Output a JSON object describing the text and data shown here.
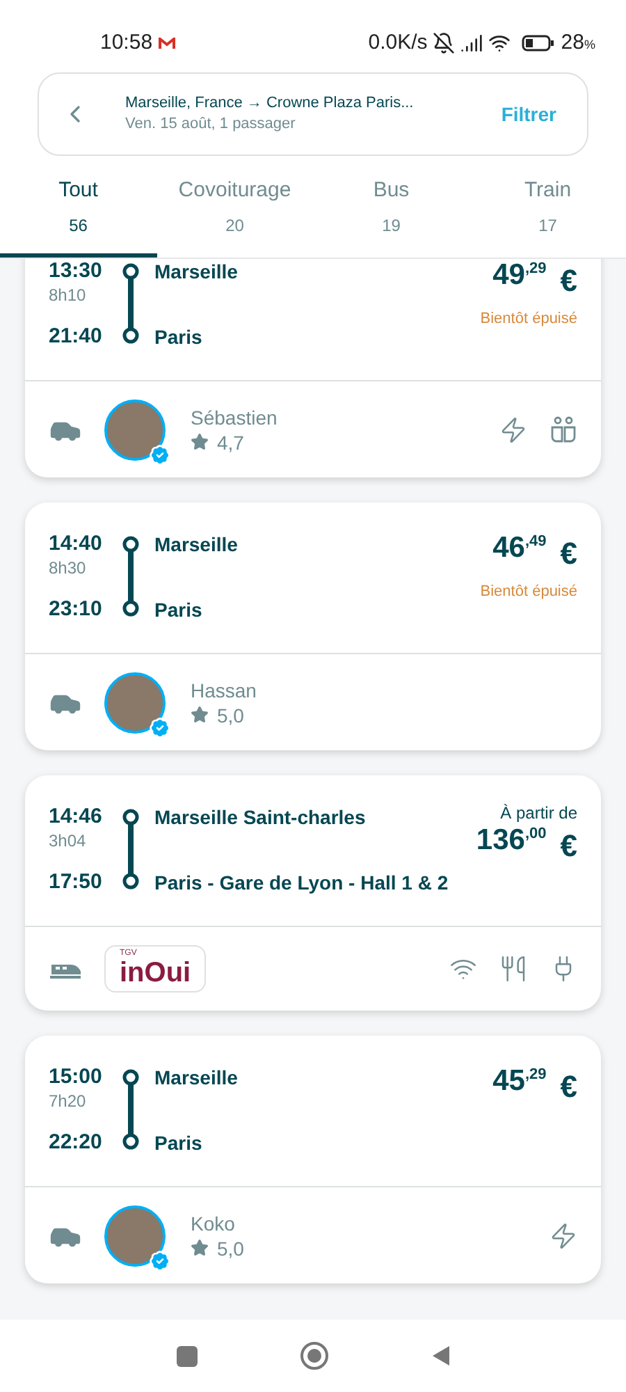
{
  "status_bar": {
    "time": "10:58",
    "speed": "0.0K/s",
    "battery": "28",
    "battery_unit": "%"
  },
  "search": {
    "route": "Marseille, France → Crowne Plaza Paris...",
    "details": "Ven. 15 août, 1 passager",
    "filter": "Filtrer"
  },
  "tabs": [
    {
      "label": "Tout",
      "count": "56",
      "selected": true
    },
    {
      "label": "Covoiturage",
      "count": "20",
      "selected": false
    },
    {
      "label": "Bus",
      "count": "19",
      "selected": false
    },
    {
      "label": "Train",
      "count": "17",
      "selected": false
    }
  ],
  "trips": [
    {
      "kind": "carpool",
      "depart": "13:30",
      "duration": "8h10",
      "arrive": "21:40",
      "from": "Marseille",
      "to": "Paris",
      "price": "49",
      "cents": ",29",
      "currency": "€",
      "note": "Bientôt épuisé",
      "driver": {
        "name": "Sébastien",
        "rating": "4,7"
      },
      "amenities": [
        {
          "kind": "bolt"
        },
        {
          "kind": "two-seats"
        }
      ]
    },
    {
      "kind": "carpool",
      "depart": "14:40",
      "duration": "8h30",
      "arrive": "23:10",
      "from": "Marseille",
      "to": "Paris",
      "price": "46",
      "cents": ",49",
      "currency": "€",
      "note": "Bientôt épuisé",
      "driver": {
        "name": "Hassan",
        "rating": "5,0"
      }
    },
    {
      "kind": "train",
      "depart": "14:46",
      "duration": "3h04",
      "arrive": "17:50",
      "from": "Marseille Saint-charles",
      "to": "Paris - Gare de Lyon - Hall 1 & 2",
      "price_prefix": "À partir de",
      "price": "136",
      "cents": ",00",
      "currency": "€",
      "operator": {
        "small": "TGV",
        "name": "inOui"
      },
      "amenities": [
        {
          "kind": "wifi"
        },
        {
          "kind": "food"
        },
        {
          "kind": "plug"
        }
      ]
    },
    {
      "kind": "carpool",
      "depart": "15:00",
      "duration": "7h20",
      "arrive": "22:20",
      "from": "Marseille",
      "to": "Paris",
      "price": "45",
      "cents": ",29",
      "currency": "€",
      "driver": {
        "name": "Koko",
        "rating": "5,0"
      },
      "amenities": [
        {
          "kind": "bolt"
        }
      ]
    }
  ]
}
